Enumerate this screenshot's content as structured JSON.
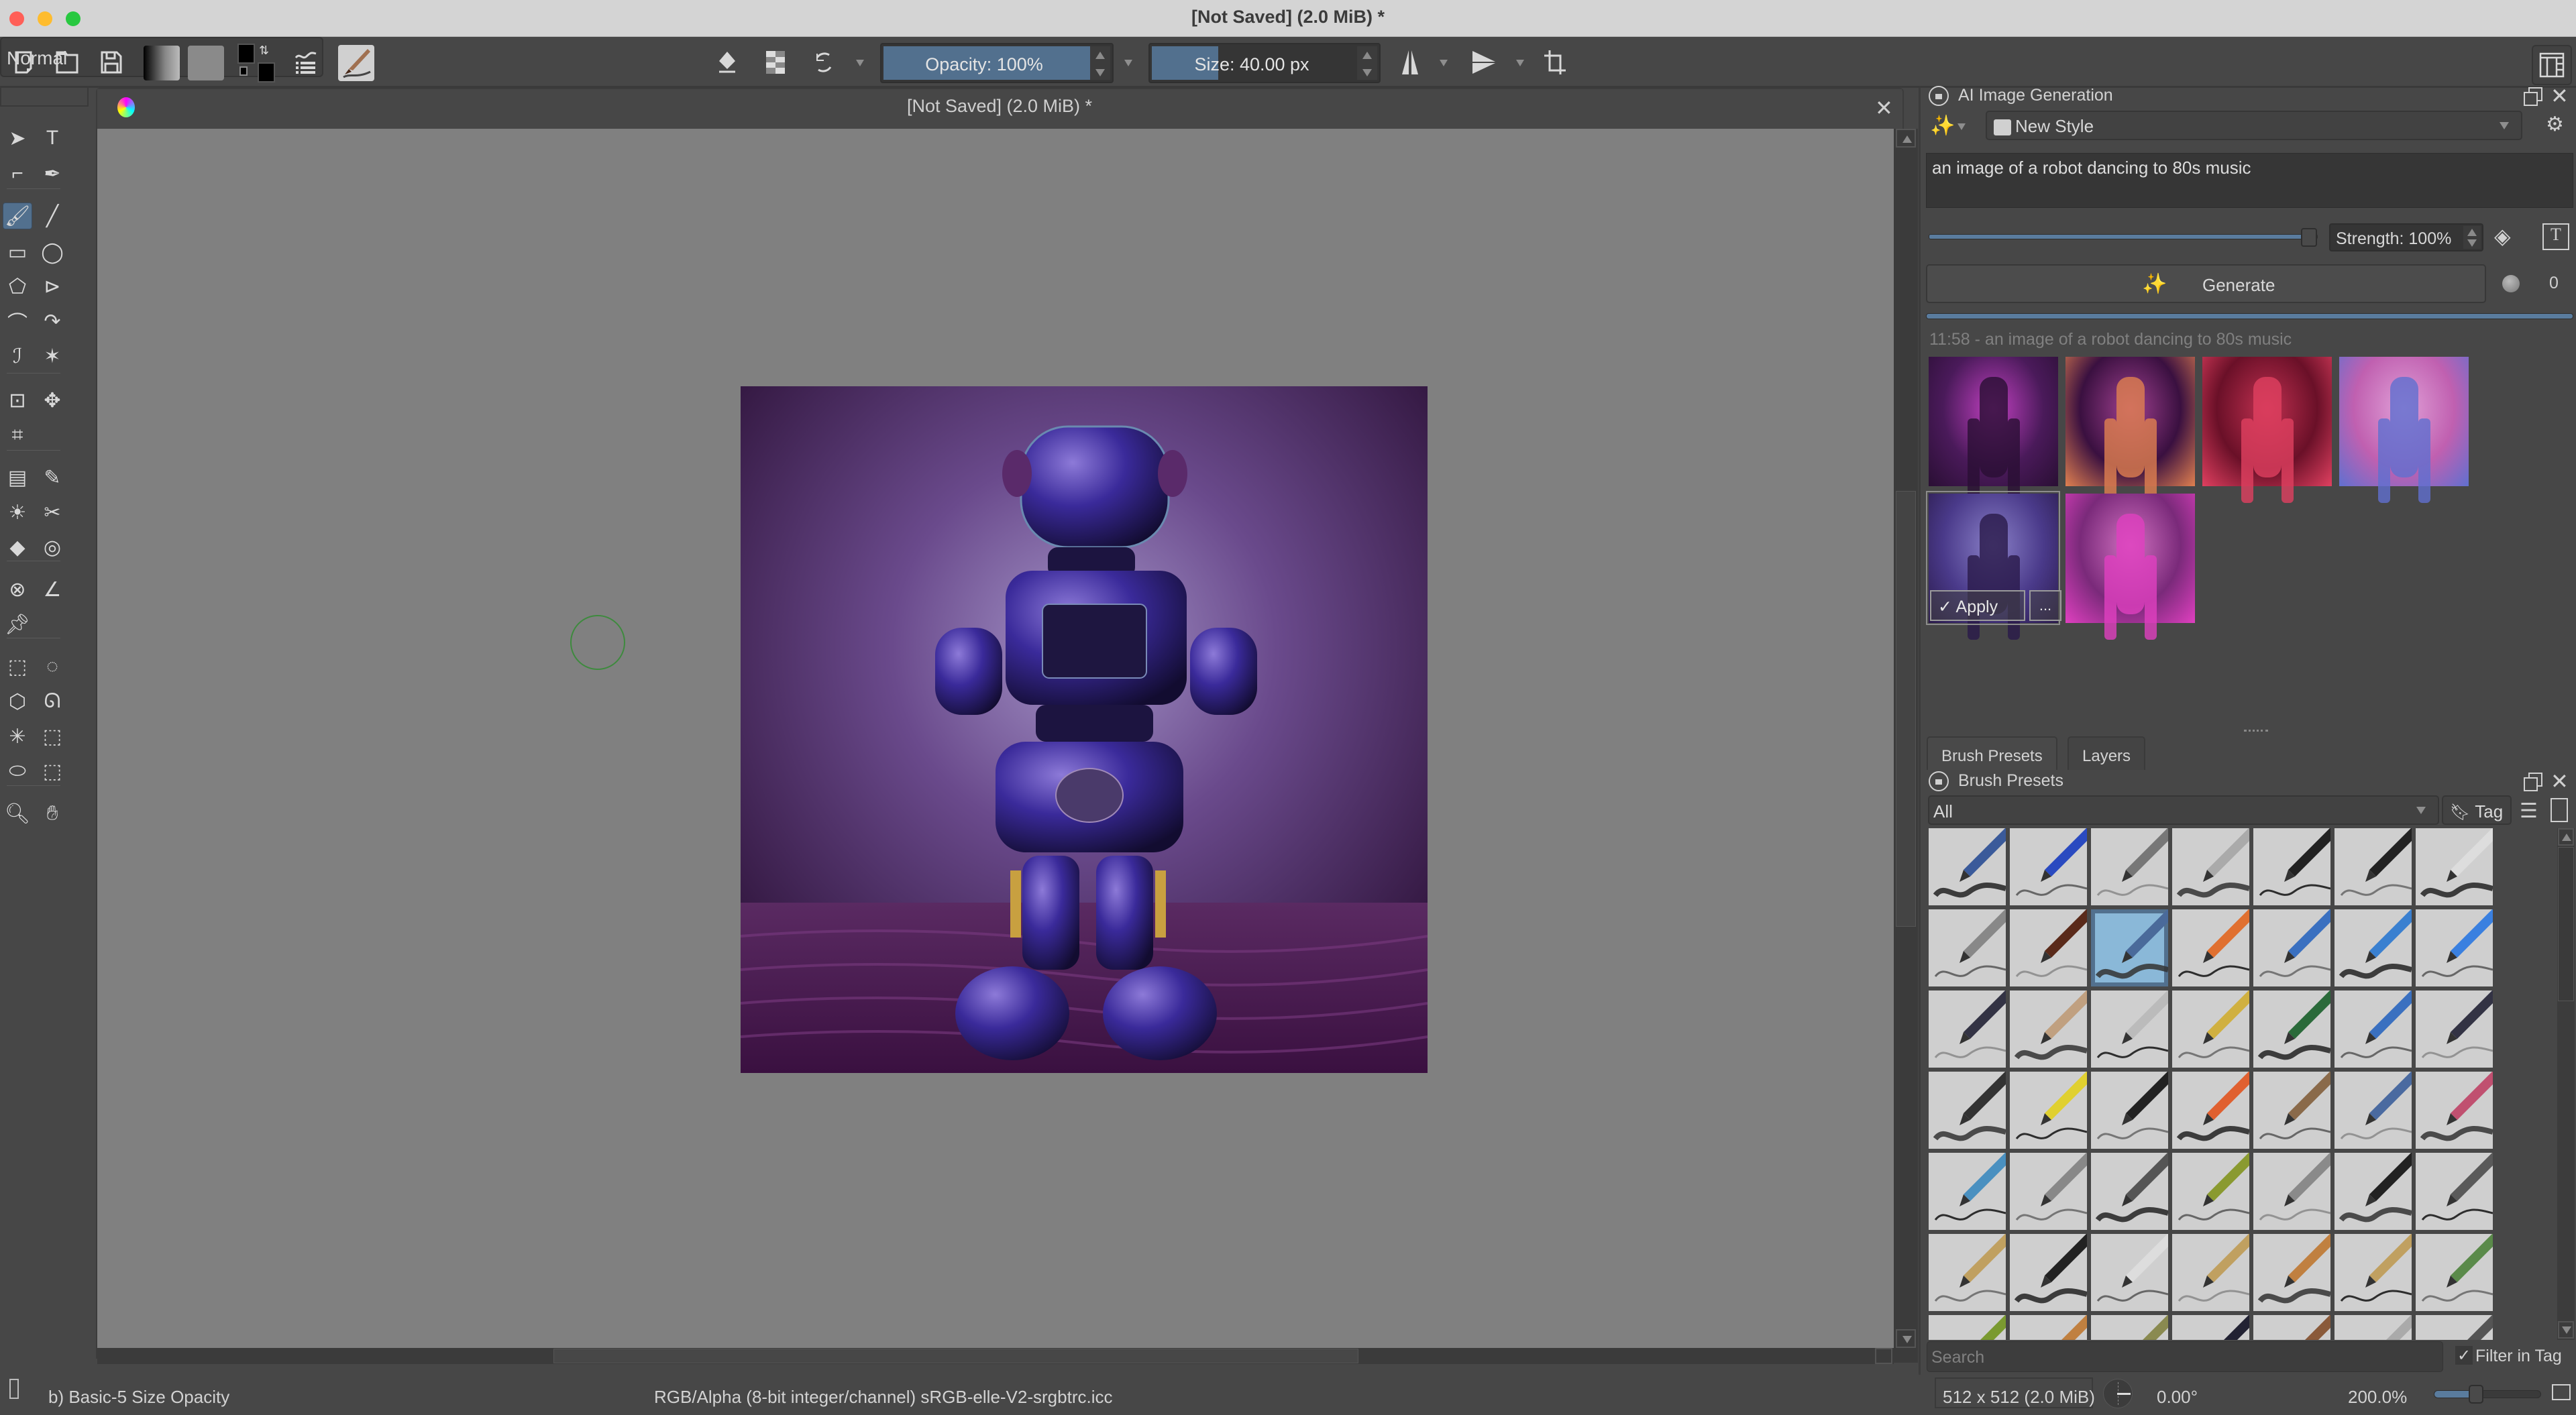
{
  "window": {
    "title": "[Not Saved]  (2.0 MiB) *",
    "traffic_lights": {
      "close": "#ff5f57",
      "minimize": "#febc2e",
      "zoom": "#28c840"
    }
  },
  "toolbar": {
    "icons": [
      "new-document-icon",
      "open-document-icon",
      "save-icon",
      "gradient-icon",
      "pattern-icon",
      "color-swap-icon",
      "brush-settings-icon",
      "brush-preset-icon"
    ],
    "blend_mode": "Normal",
    "opacity_label": "Opacity: 100%",
    "opacity_value": 1.0,
    "size_label": "Size: 40.00 px",
    "size_fill_fraction": 0.32,
    "accent_color": "#52708e"
  },
  "document": {
    "tab_title": "[Not Saved]  (2.0 MiB) *",
    "zoom_percent": 200
  },
  "toolbox": {
    "tools": [
      "select-shapes",
      "text",
      "edit-shapes",
      "calligraphy",
      "freehand-brush",
      "line",
      "rectangle",
      "ellipse",
      "polygon",
      "polyline",
      "bezier-curve",
      "freehand-path",
      "dynamic-brush",
      "multibrush",
      "transform",
      "move",
      "crop",
      "gradient",
      "color-sampler",
      "colorize-mask",
      "smart-patch",
      "fill",
      "enclose-fill",
      "assistant",
      "measure",
      "reference-images",
      "rect-select",
      "ellipse-select",
      "polygon-select",
      "freehand-select",
      "contiguous-select",
      "similar-select",
      "bezier-select",
      "magnetic-select",
      "zoom",
      "pan"
    ],
    "active_tool": "freehand-brush"
  },
  "ai_panel": {
    "title": "AI Image Generation",
    "style": "New Style",
    "prompt": "an image of a robot dancing to 80s music",
    "strength_label": "Strength: 100%",
    "strength_value": 1.0,
    "generate_label": "Generate",
    "queue_count": "0",
    "progress": 1.0,
    "history_label": "11:58 - an image of a robot dancing to 80s music",
    "apply_label": "Apply",
    "more_label": "...",
    "thumbnail_count": 6,
    "selected_thumbnail": 4
  },
  "dock_tabs": [
    {
      "label": "Brush Presets",
      "active": true
    },
    {
      "label": "Layers",
      "active": false
    }
  ],
  "brush_presets": {
    "title": "Brush Presets",
    "filter": "All",
    "tag_label": "Tag",
    "search_placeholder": "Search",
    "filter_in_tag_label": "Filter in Tag",
    "filter_in_tag_checked": true,
    "selected_index": 9,
    "visible_count": 49
  },
  "statusbar": {
    "brush_name": "b) Basic-5 Size Opacity",
    "color_profile": "RGB/Alpha (8-bit integer/channel)  sRGB-elle-V2-srgbtrc.icc",
    "dimensions": "512 x 512 (2.0 MiB)",
    "rotation": "0.00°",
    "zoom": "200.0%",
    "zoom_slider_fraction": 0.36
  }
}
